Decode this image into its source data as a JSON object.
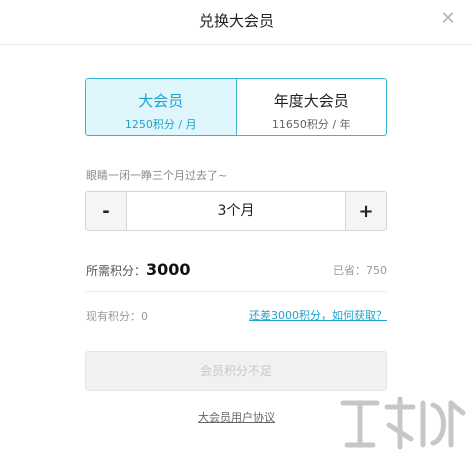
{
  "header": {
    "title": "兑换大会员",
    "close_icon": "close-icon"
  },
  "plans": [
    {
      "name": "大会员",
      "price": "1250积分 / 月",
      "selected": true
    },
    {
      "name": "年度大会员",
      "price": "11650积分 / 年",
      "selected": false
    }
  ],
  "hint": "眼睛一闭一睁三个月过去了~",
  "stepper": {
    "minus_label": "-",
    "plus_label": "+",
    "value": "3个月"
  },
  "summary": {
    "required_label": "所需积分：",
    "required_value": "3000",
    "saved_text": "已省：750",
    "current_text": "现有积分：0",
    "how_link": "还差3000积分，如何获取？"
  },
  "submit_label": "会员积分不足",
  "agreement_link": "大会员用户协议",
  "colors": {
    "accent": "#1ea3cf",
    "selected_bg": "#dff6fc"
  }
}
